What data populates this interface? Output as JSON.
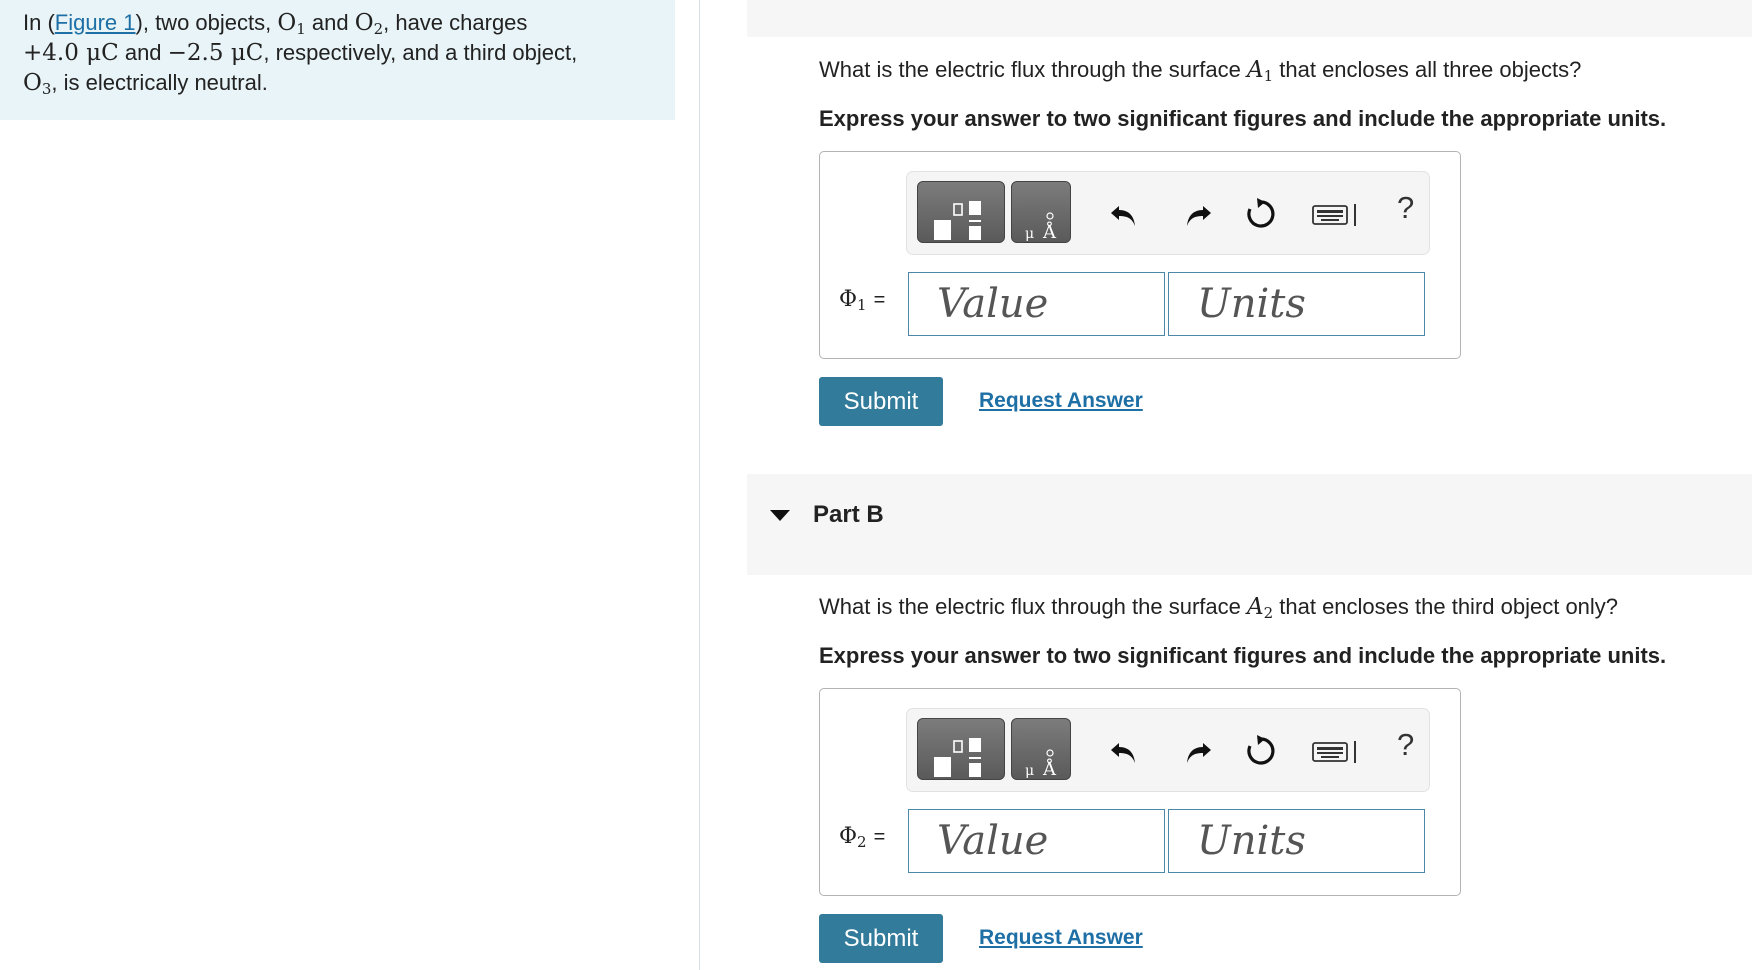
{
  "intro": {
    "prefix": "In (",
    "figure_link": "Figure 1",
    "t1": "), two objects, ",
    "o": "O",
    "sub1": "1",
    "t2": " and ",
    "sub2": "2",
    "t3": ", have charges",
    "charge1": "+4.0 μC",
    "t4": " and ",
    "charge2": "−2.5 μC",
    "t5": ", respectively, and a third object,",
    "sub3": "3",
    "t6": ", is electrically neutral."
  },
  "part_a": {
    "question_pre": "What is the electric flux through the surface ",
    "surface": "A",
    "surface_sub": "1",
    "question_post": " that encloses all three objects?",
    "instruction": "Express your answer to two significant figures and include the appropriate units.",
    "phi_symbol": "Φ",
    "phi_sub": "1",
    "equals": "=",
    "value_placeholder": "Value",
    "units_placeholder": "Units",
    "submit_label": "Submit",
    "request_label": "Request Answer"
  },
  "part_b": {
    "title": "Part B",
    "question_pre": "What is the electric flux through the surface ",
    "surface": "A",
    "surface_sub": "2",
    "question_post": " that encloses the third object only?",
    "instruction": "Express your answer to two significant figures and include the appropriate units.",
    "phi_symbol": "Φ",
    "phi_sub": "2",
    "equals": "=",
    "value_placeholder": "Value",
    "units_placeholder": "Units",
    "submit_label": "Submit",
    "request_label": "Request Answer"
  },
  "toolbar": {
    "help_label": "?",
    "icons": [
      "templates-icon",
      "units-icon",
      "undo-icon",
      "redo-icon",
      "reset-icon",
      "keyboard-icon",
      "help-icon"
    ],
    "units_glyph": "Å"
  },
  "colors": {
    "accent": "#337b9a",
    "link": "#1d6fa5",
    "intro_bg": "#e8f4f7",
    "field_border": "#4c88a8"
  }
}
